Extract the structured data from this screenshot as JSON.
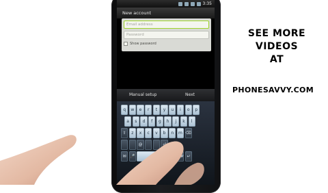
{
  "phone": {
    "status_time": "3:35",
    "title": "New account",
    "email_placeholder": "Email address",
    "password_placeholder": "Password",
    "show_password_label": "Show password",
    "show_password_checked": false,
    "manual_setup_label": "Manual setup",
    "next_label": "Next"
  },
  "keyboard": {
    "rows": [
      [
        "q",
        "w",
        "e",
        "r",
        "t",
        "y",
        "u",
        "i",
        "o",
        "p"
      ],
      [
        "a",
        "s",
        "d",
        "f",
        "g",
        "h",
        "j",
        "k",
        "l"
      ],
      [
        "⇧",
        "z",
        "x",
        "c",
        "v",
        "b",
        "n",
        "m",
        "⌫"
      ],
      [
        "",
        "",
        "@",
        "",
        "",
        "⏎"
      ],
      [
        "✉",
        "🎤",
        "",
        "",
        "12#",
        "↵"
      ]
    ]
  },
  "promo": {
    "line1": "SEE MORE",
    "line2": "VIDEOS",
    "line3": "AT",
    "site": "PHONESAVVY.COM"
  },
  "colors": {
    "background": "#ffffff",
    "phone_body": "#111214",
    "field_active_border": "#9ed42b",
    "key_face": "#cfdeea",
    "promo_text": "#000000"
  }
}
